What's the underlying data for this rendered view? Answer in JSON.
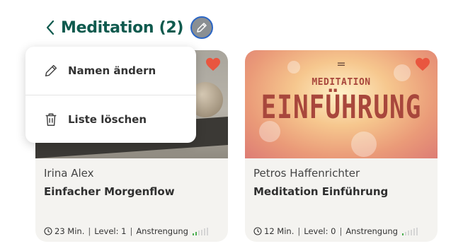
{
  "header": {
    "title": "Meditation (2)",
    "back_icon": "chevron-left-icon",
    "edit_icon": "pencil-icon"
  },
  "menu": {
    "items": [
      {
        "label": "Namen ändern",
        "icon": "pencil-icon"
      },
      {
        "label": "Liste löschen",
        "icon": "trash-icon"
      }
    ]
  },
  "cards": [
    {
      "author": "Irina Alex",
      "title": "Einfacher Morgenflow",
      "duration": "23 Min.",
      "level": "Level: 1",
      "effort_label": "Anstrengung",
      "effort_level": 2,
      "effort_max": 6,
      "favorite": true
    },
    {
      "author": "Petros Haffenrichter",
      "title": "Meditation Einführung",
      "duration": "12 Min.",
      "level": "Level: 0",
      "effort_label": "Anstrengung",
      "effort_level": 1,
      "effort_max": 6,
      "favorite": true,
      "thumbnail_text": {
        "top": "=",
        "small": "MEDITATION",
        "big": "EINFÜHRUNG"
      }
    }
  ],
  "colors": {
    "title": "#0f5a4e",
    "heart": "#e9563f",
    "effort_active": "#4caf50",
    "effort_inactive": "#d5d5d5"
  }
}
